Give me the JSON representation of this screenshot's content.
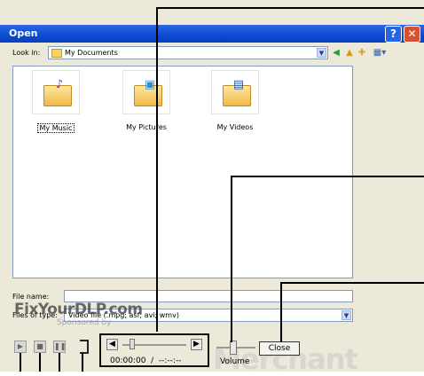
{
  "window": {
    "title": "Open"
  },
  "toolbar": {
    "lookin_label": "Look in:",
    "lookin_value": "My Documents"
  },
  "folders": [
    {
      "label": "My Music",
      "selected": true,
      "badge": "music-note"
    },
    {
      "label": "My Pictures",
      "selected": false,
      "badge": "picture"
    },
    {
      "label": "My Videos",
      "selected": false,
      "badge": "film"
    }
  ],
  "form": {
    "file_name_label": "File name:",
    "file_name_value": "",
    "file_type_label": "Files of type:",
    "file_type_value": "Video file (.mpg; asf; avi; wmv)"
  },
  "player": {
    "time_text": "00:00:00  /  --:--:--",
    "volume_label": "Volume",
    "close_label": "Close"
  },
  "watermark": {
    "brand": "FixYourDLP.com",
    "sponsor": "Sponsored by",
    "overlay": "Merchant"
  },
  "colors": {
    "title_bar": "#0a4bd3",
    "dialog_bg": "#ece9d8",
    "close_red": "#d6512f"
  }
}
